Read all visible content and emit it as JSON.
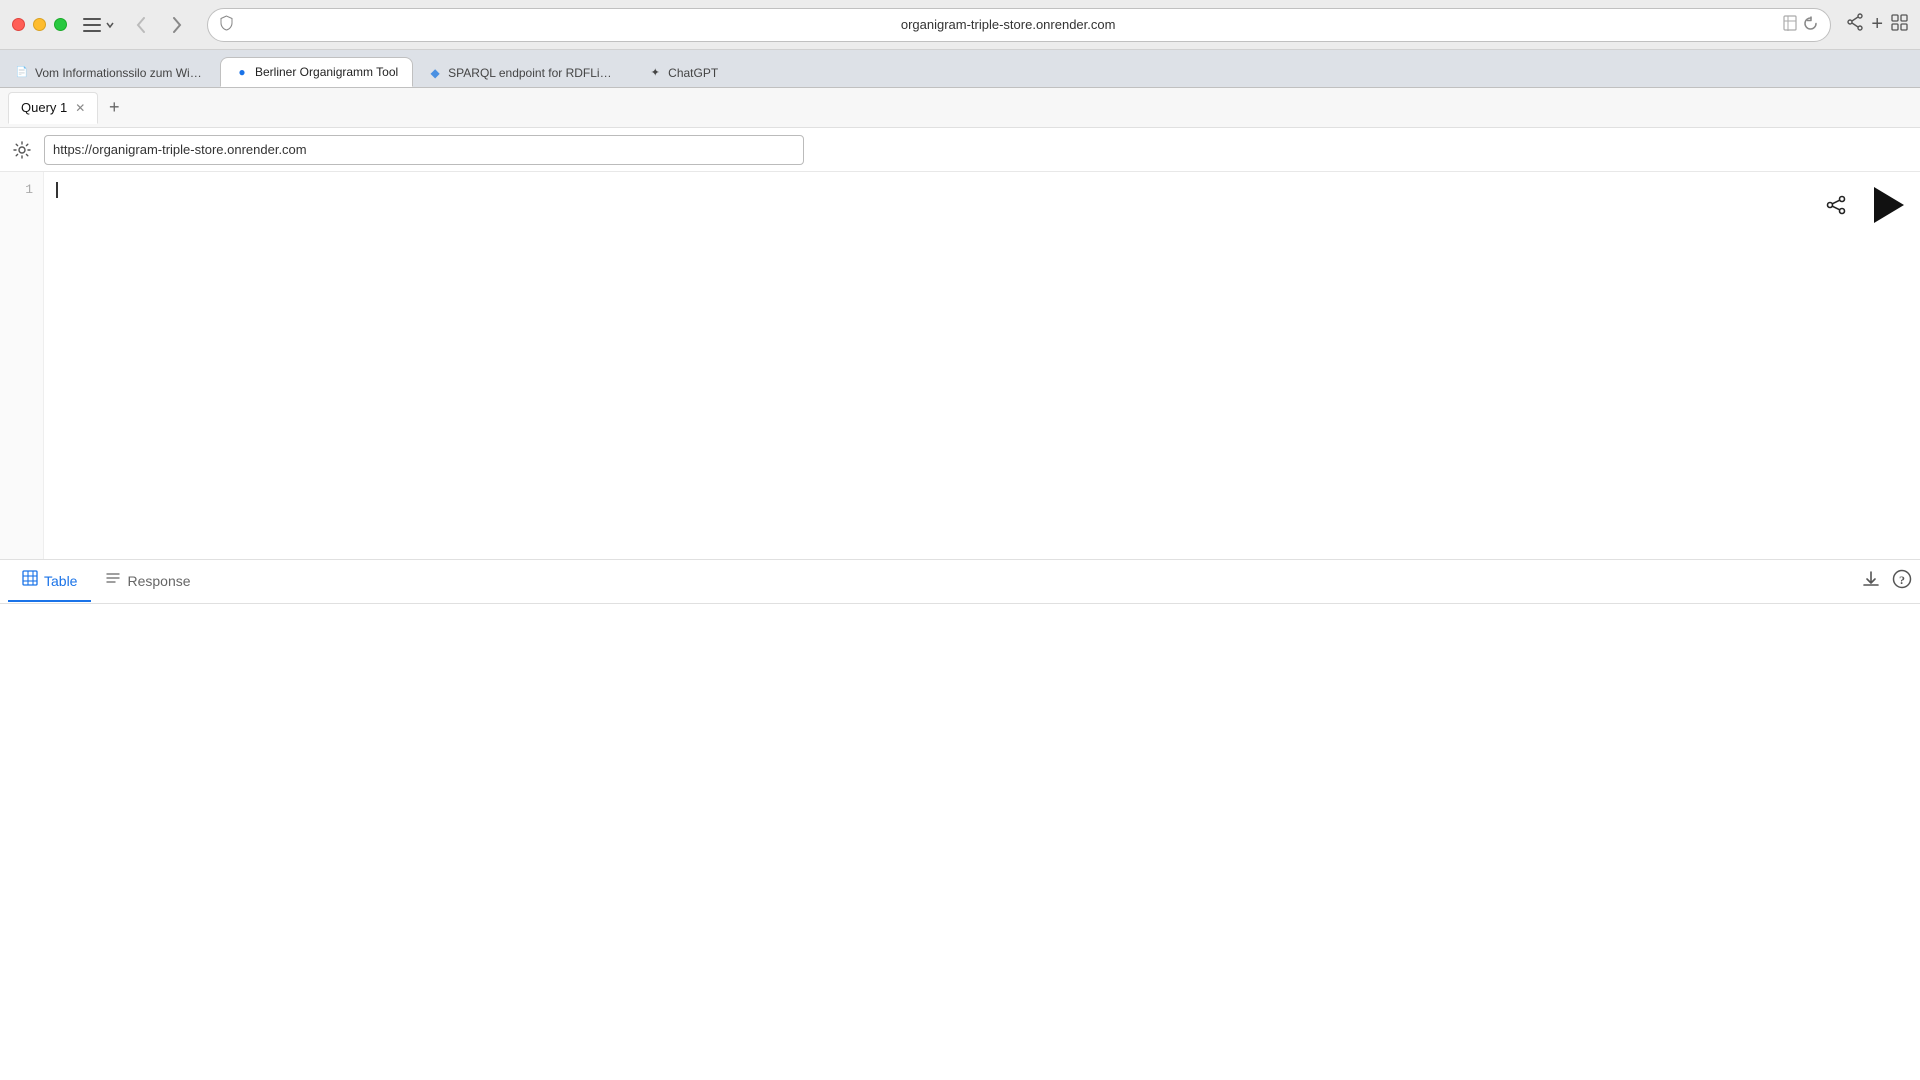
{
  "os": {
    "background_color": "#b090c0"
  },
  "browser": {
    "address": "organigram-triple-store.onrender.com",
    "address_full": "https://organigram-triple-store.onrender.com",
    "tabs": [
      {
        "id": "tab-1",
        "label": "Vom Informationssilo zum Wissensnetzwerk",
        "favicon": "📄",
        "active": false
      },
      {
        "id": "tab-2",
        "label": "Berliner Organigramm Tool",
        "favicon": "🔵",
        "active": true
      },
      {
        "id": "tab-3",
        "label": "SPARQL endpoint for RDFLib graph",
        "favicon": "🔷",
        "active": false
      },
      {
        "id": "tab-4",
        "label": "ChatGPT",
        "favicon": "✦",
        "active": false
      }
    ]
  },
  "app": {
    "query_tabs": [
      {
        "id": "query-1",
        "label": "Query 1",
        "active": true,
        "closeable": true
      }
    ],
    "add_tab_label": "+",
    "endpoint_url": "https://organigram-triple-store.onrender.com",
    "line_numbers": [
      "1"
    ],
    "editor_placeholder": "",
    "run_button_title": "Run Query",
    "share_button_title": "Share Query",
    "result_tabs": [
      {
        "id": "result-table",
        "label": "Table",
        "icon": "⊞",
        "active": true
      },
      {
        "id": "result-response",
        "label": "Response",
        "icon": "≡",
        "active": false
      }
    ],
    "download_button_title": "Download",
    "help_button_title": "Help"
  }
}
